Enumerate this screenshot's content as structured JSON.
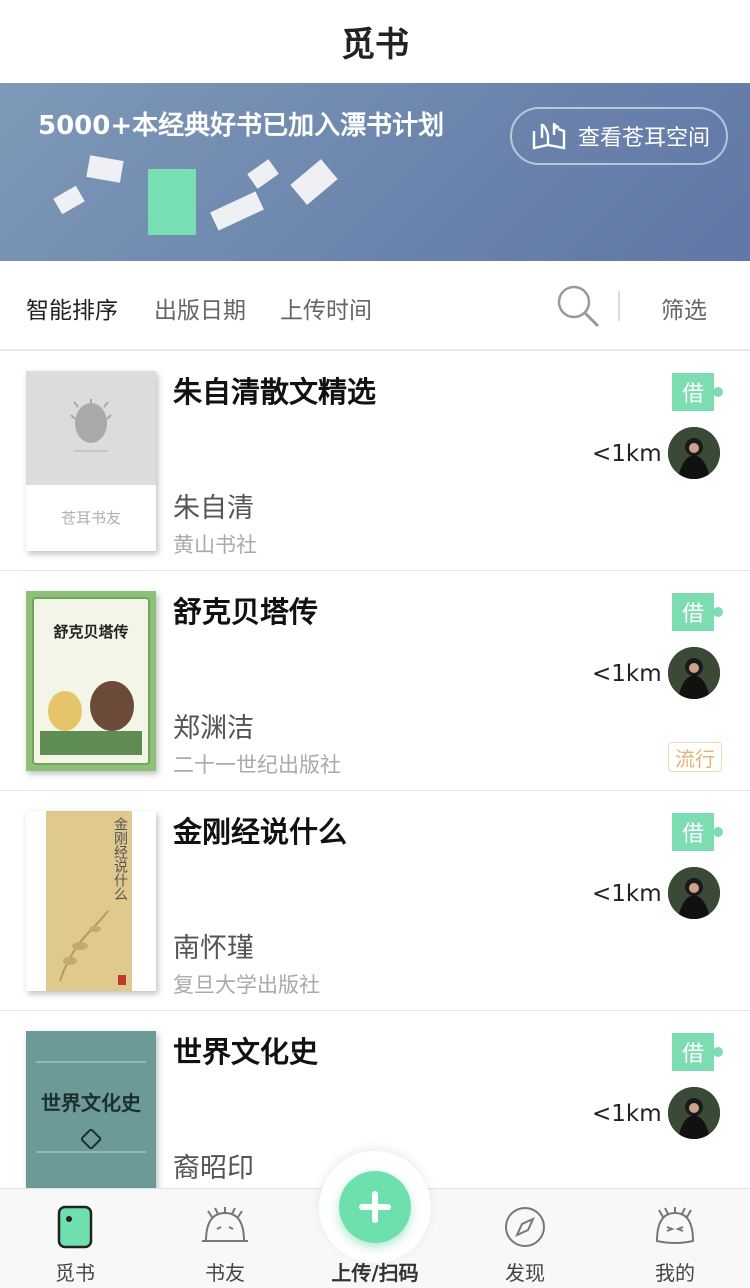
{
  "header": {
    "title": "觅书"
  },
  "banner": {
    "headline": "5000+本经典好书已加入漂书计划",
    "button_label": "查看苍耳空间"
  },
  "sortbar": {
    "tabs": [
      "智能排序",
      "出版日期",
      "上传时间"
    ],
    "filter_label": "筛选"
  },
  "books": [
    {
      "title": "朱自清散文精选",
      "author": "朱自清",
      "publisher": "黄山书社",
      "borrow": "借",
      "distance": "<1km",
      "tag": "",
      "cover_text": "苍耳书友"
    },
    {
      "title": "舒克贝塔传",
      "author": "郑渊洁",
      "publisher": "二十一世纪出版社",
      "borrow": "借",
      "distance": "<1km",
      "tag": "流行",
      "cover_text": "舒克贝塔传"
    },
    {
      "title": "金刚经说什么",
      "author": "南怀瑾",
      "publisher": "复旦大学出版社",
      "borrow": "借",
      "distance": "<1km",
      "tag": "",
      "cover_text": "金刚经说什么"
    },
    {
      "title": "世界文化史",
      "author": "裔昭印",
      "publisher": "",
      "borrow": "借",
      "distance": "<1km",
      "tag": "",
      "cover_text": "世界文化史"
    }
  ],
  "tabbar": {
    "items": [
      "觅书",
      "书友",
      "上传/扫码",
      "发现",
      "我的"
    ]
  },
  "colors": {
    "accent": "#7edcb2",
    "banner": "#6a83ac",
    "tag": "#e3b47a"
  }
}
